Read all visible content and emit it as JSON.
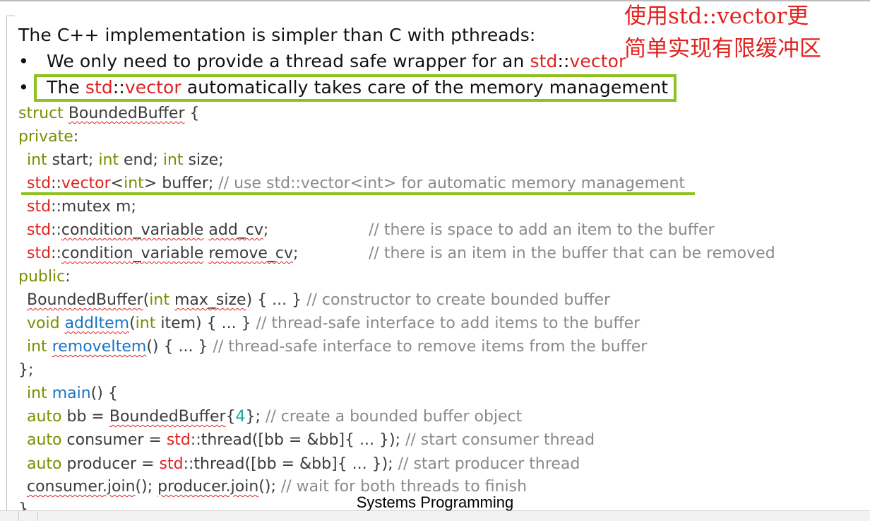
{
  "slide": {
    "heading": "The C++ implementation is simpler than C with pthreads:",
    "bullets": [
      {
        "symbol": "•",
        "prefix": "We only need to provide a thread safe wrapper for an ",
        "std": "std",
        "sep": "::",
        "vector": "vector",
        "suffix": ""
      },
      {
        "symbol": "•",
        "prefix": "The ",
        "std": "std",
        "sep": "::",
        "vector": "vector",
        "suffix": " automatically takes care of the memory management"
      }
    ],
    "annotation": [
      "使用std::vector更",
      "简单实现有限缓冲区"
    ],
    "code": {
      "l1": {
        "struct": "struct",
        "name": "BoundedBuffer",
        "brace": " {"
      },
      "l2": {
        "private": "private",
        "colon": ":"
      },
      "l3": {
        "int1": "int",
        "t1": " start; ",
        "int2": "int",
        "t2": " end; ",
        "int3": "int",
        "t3": " size;"
      },
      "l4": {
        "std": "std",
        "sep": "::",
        "vector": "vector",
        "lt": "<",
        "int": "int",
        "rest": "> buffer; ",
        "comment": "// use std::vector<int> for automatic memory management"
      },
      "l5": {
        "std": "std",
        "rest": "::mutex m;"
      },
      "l6": {
        "std": "std",
        "sep": "::",
        "type": "condition_variable",
        "sp": " ",
        "var": "add_cv",
        "semi": ";",
        "comment": "// there is space to add an item to the buffer"
      },
      "l7": {
        "std": "std",
        "sep": "::",
        "type": "condition_variable",
        "sp": " ",
        "var": "remove_cv",
        "semi": ";",
        "comment": "// there is an item in the buffer that can be removed"
      },
      "l8": {
        "public": "public",
        "colon": ":"
      },
      "l9": {
        "ctor": "BoundedBuffer",
        "paren": "(",
        "int": "int",
        "sp": " ",
        "param": "max_size",
        "rest": ") { ... } ",
        "comment": "// constructor to create bounded buffer"
      },
      "l10": {
        "void": "void",
        "sp": " ",
        "fn": "addItem",
        "paren": "(",
        "int": "int",
        "rest": " item) { ... } ",
        "comment": "// thread-safe interface to add items to the buffer"
      },
      "l11": {
        "int": "int",
        "sp": " ",
        "fn": "removeItem",
        "rest": "() { ... } ",
        "comment": "// thread-safe interface to remove items from the buffer"
      },
      "l12": {
        "text": "};"
      },
      "l13": {
        "int": "int",
        "sp": " ",
        "fn": "main",
        "rest": "() {"
      },
      "l14": {
        "auto": "auto",
        "t1": " bb = ",
        "ctor": "BoundedBuffer",
        "ob": "{",
        "num": "4",
        "cb": "}",
        "t2": "; ",
        "comment": "// create a bounded buffer object"
      },
      "l15": {
        "auto": "auto",
        "t1": " consumer = ",
        "std": "std",
        "t2": "::thread([bb = &bb]{ ... }); ",
        "comment": "// start consumer thread"
      },
      "l16": {
        "auto": "auto",
        "t1": " producer = ",
        "std": "std",
        "t2": "::thread([bb = &bb]{ ... }); ",
        "comment": "// start producer thread"
      },
      "l17": {
        "c1": "consumer.join",
        "t1": "(); ",
        "c2": "producer.join",
        "t2": "(); ",
        "comment": "// wait for both threads to finish"
      },
      "l18": {
        "text": "}"
      }
    },
    "footer": "Systems Programming"
  },
  "colors": {
    "keyword": "#7a8f00",
    "std_red": "#e0221f",
    "function_blue": "#1c74c4",
    "comment_gray": "#8a8a8a",
    "highlight_green": "#8ec21f",
    "annotation_red": "#e0221f"
  }
}
